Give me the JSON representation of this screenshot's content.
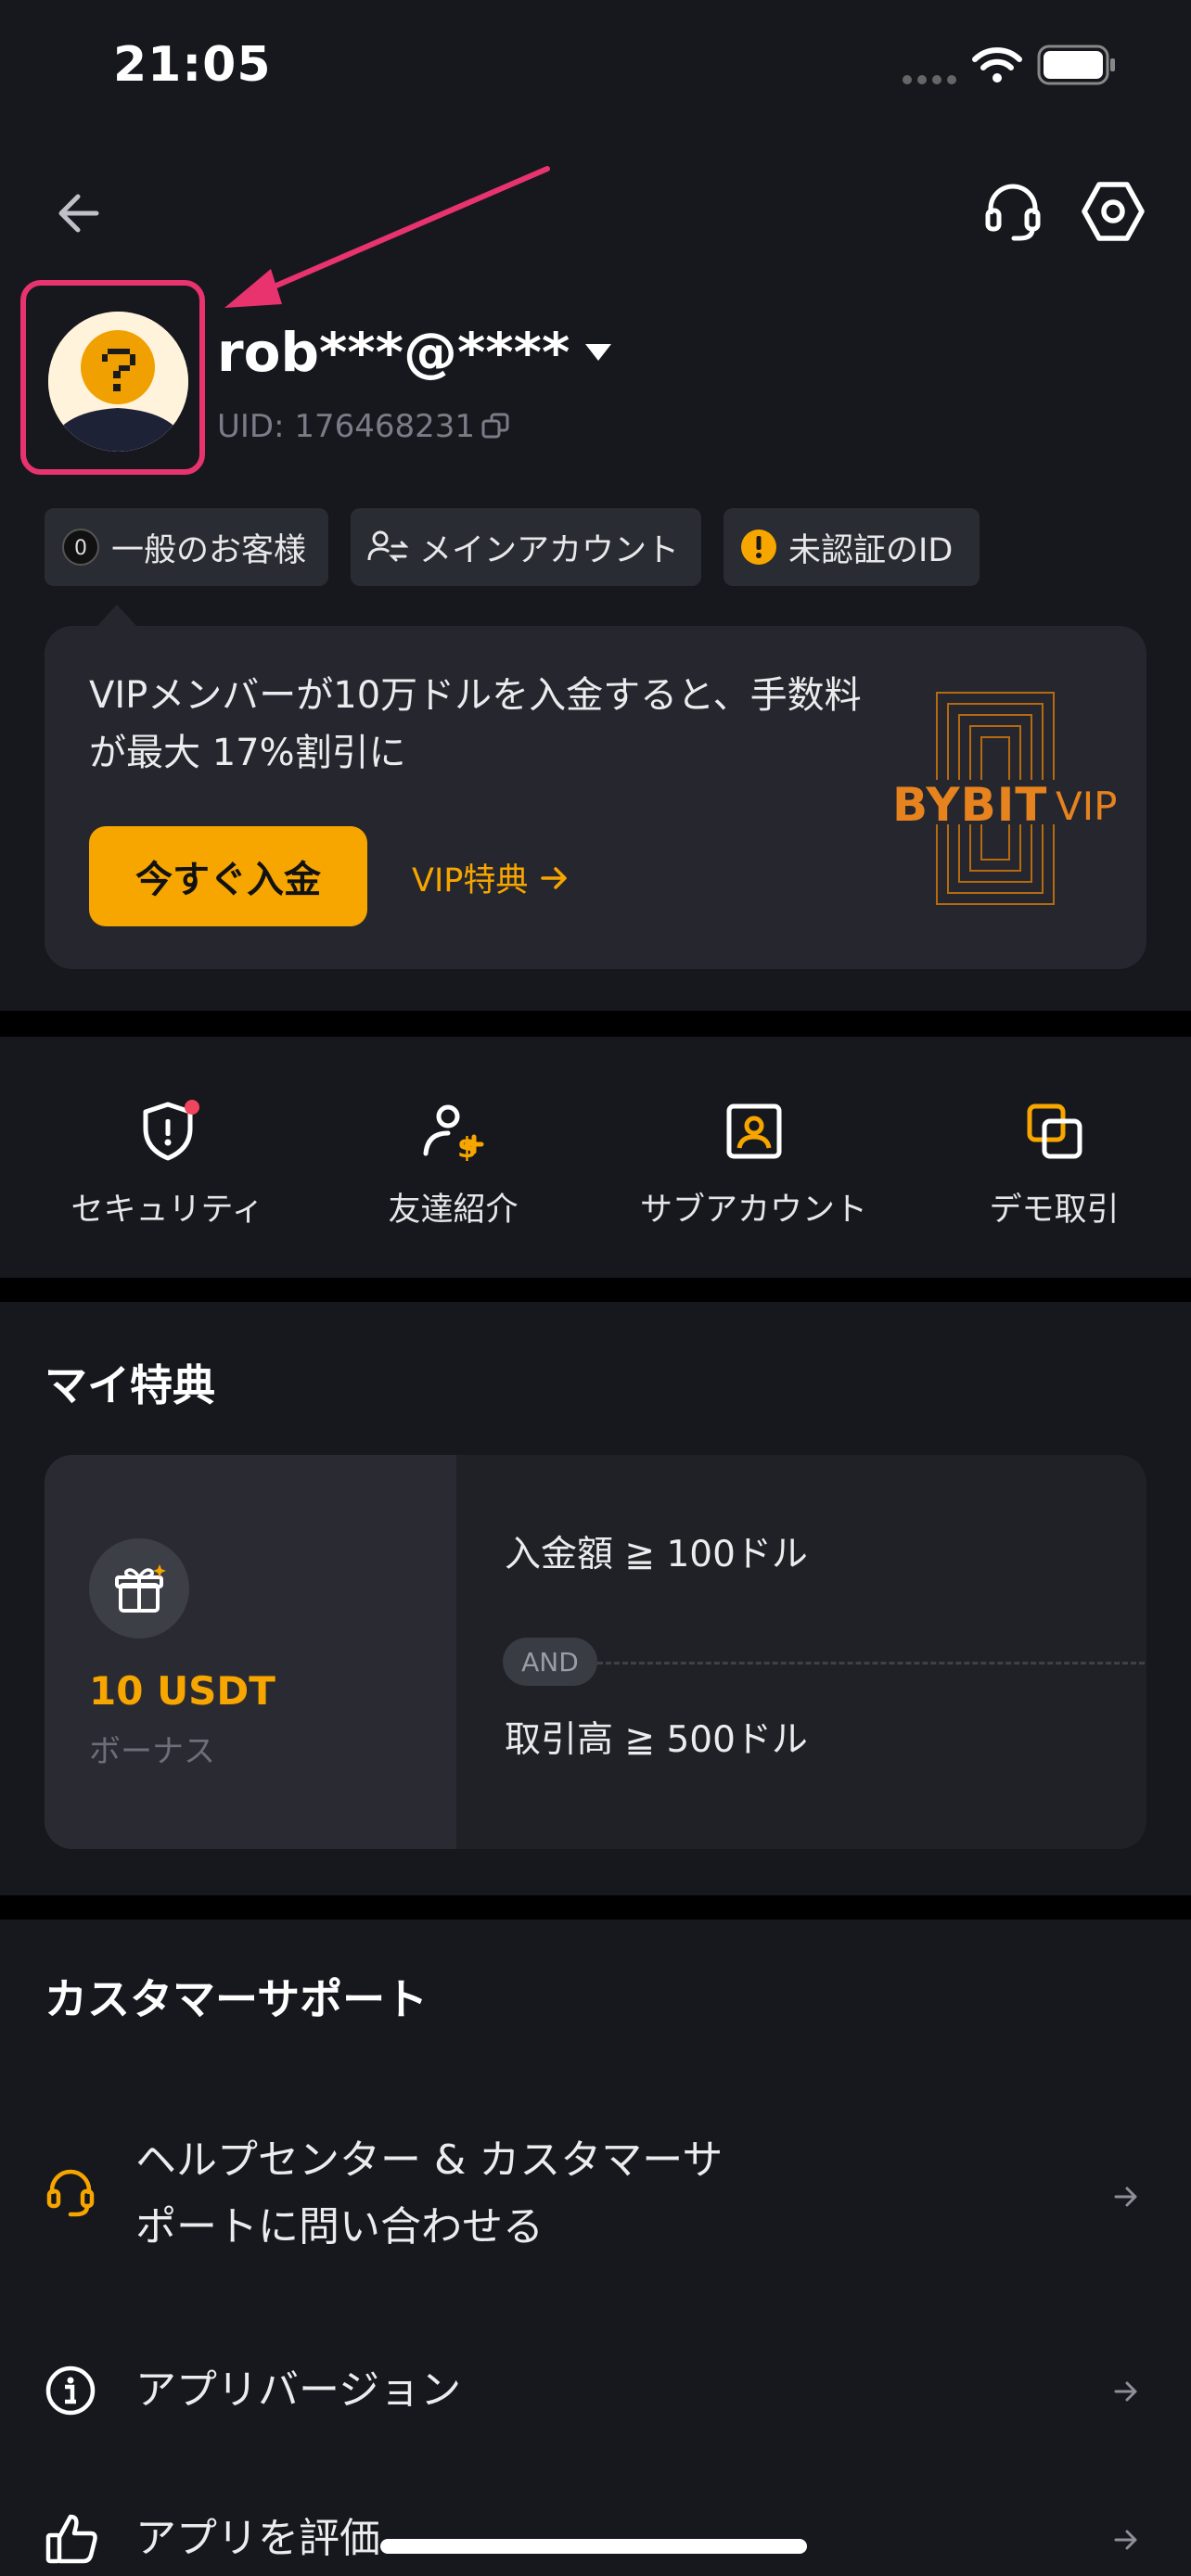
{
  "status_bar": {
    "time": "21:05"
  },
  "profile": {
    "username": "rob***@****",
    "uid": "UID: 176468231"
  },
  "tags": [
    {
      "icon": "zero-badge-icon",
      "label": "一般のお客様"
    },
    {
      "icon": "user-switch-icon",
      "label": "メインアカウント"
    },
    {
      "icon": "warning-icon",
      "label": "未認証のID"
    }
  ],
  "vip": {
    "promo": "VIPメンバーが10万ドルを入金すると、手数料が最大 17%割引に",
    "deposit_button": "今すぐ入金",
    "benefits_link": "VIP特典",
    "logo_text": "BYBIT",
    "logo_suffix": "VIP"
  },
  "quick_actions": [
    {
      "icon": "security-shield-icon",
      "label": "セキュリティ"
    },
    {
      "icon": "referral-icon",
      "label": "友達紹介"
    },
    {
      "icon": "subaccount-icon",
      "label": "サブアカウント"
    },
    {
      "icon": "demo-trading-icon",
      "label": "デモ取引"
    }
  ],
  "benefits": {
    "title": "マイ特典",
    "amount": "10 USDT",
    "amount_label": "ボーナス",
    "condition_1": "入金額 ≧ 100ドル",
    "and_label": "AND",
    "condition_2": "取引高 ≧ 500ドル"
  },
  "support": {
    "title": "カスタマーサポート",
    "items": [
      {
        "icon": "headset-icon",
        "line1": "ヘルプセンター & カスタマーサ",
        "line2": "ポートに問い合わせる"
      },
      {
        "icon": "info-icon",
        "label": "アプリバージョン"
      },
      {
        "icon": "thumbs-up-icon",
        "label": "アプリを評価"
      }
    ]
  },
  "colors": {
    "accent": "#f7a600",
    "highlight": "#e8336f",
    "background": "#17181e",
    "card": "#26272e"
  }
}
